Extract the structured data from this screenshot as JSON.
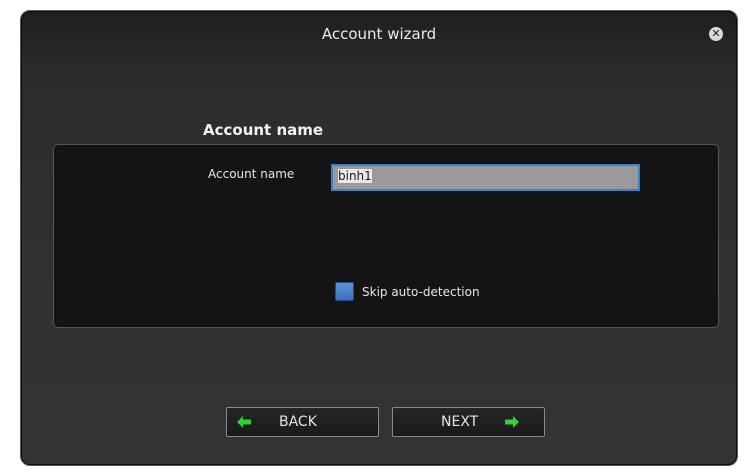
{
  "dialog": {
    "title": "Account wizard",
    "close_icon": "close-icon"
  },
  "section": {
    "heading": "Account name"
  },
  "form": {
    "account_name_label": "Account name",
    "account_name_value": "binh1",
    "skip_label": "Skip auto-detection",
    "skip_checked": false
  },
  "buttons": {
    "back_label": "BACK",
    "back_icon": "arrow-left-icon",
    "next_label": "NEXT",
    "next_icon": "arrow-right-icon",
    "arrow_color": "#2fd03a"
  },
  "colors": {
    "focus_border": "#3c80c8",
    "checkbox": "#4a82cc"
  }
}
